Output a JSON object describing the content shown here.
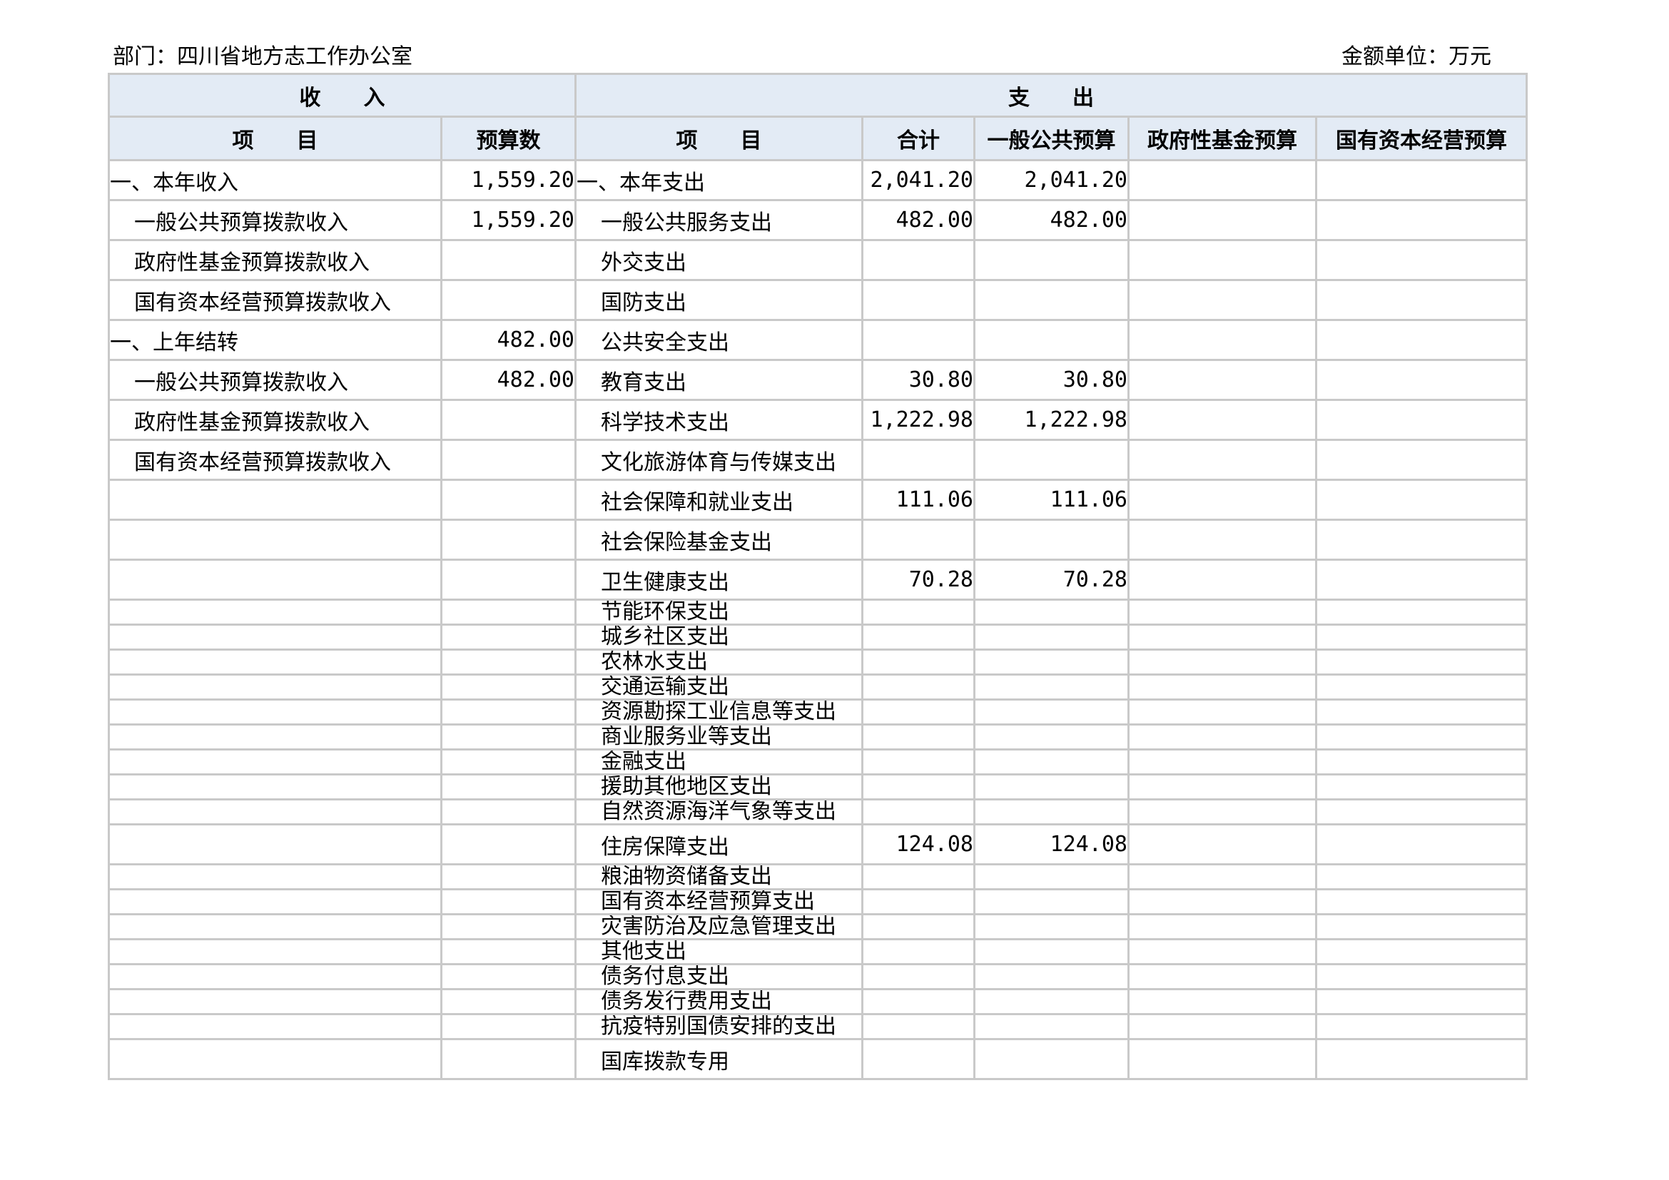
{
  "header": {
    "department": "部门：四川省地方志工作办公室",
    "unit": "金额单位：万元"
  },
  "sections": {
    "income": "收　　入",
    "expense": "支　　出"
  },
  "columns": {
    "income_item": "项　　目",
    "income_budget": "预算数",
    "expense_item": "项　　目",
    "total": "合计",
    "general": "一般公共预算",
    "fund": "政府性基金预算",
    "state_capital": "国有资本经营预算"
  },
  "rows": [
    {
      "inc": "一、本年收入",
      "inc_v": "1,559.20",
      "exp": "一、本年支出",
      "tot": "2,041.20",
      "gen": "2,041.20",
      "fund": "",
      "cap": "",
      "size": "big",
      "inc_ind": false,
      "exp_ind": false
    },
    {
      "inc": "一般公共预算拨款收入",
      "inc_v": "1,559.20",
      "exp": "一般公共服务支出",
      "tot": "482.00",
      "gen": "482.00",
      "fund": "",
      "cap": "",
      "size": "big",
      "inc_ind": true,
      "exp_ind": true
    },
    {
      "inc": "政府性基金预算拨款收入",
      "inc_v": "",
      "exp": "外交支出",
      "tot": "",
      "gen": "",
      "fund": "",
      "cap": "",
      "size": "big",
      "inc_ind": true,
      "exp_ind": true
    },
    {
      "inc": "国有资本经营预算拨款收入",
      "inc_v": "",
      "exp": "国防支出",
      "tot": "",
      "gen": "",
      "fund": "",
      "cap": "",
      "size": "big",
      "inc_ind": true,
      "exp_ind": true
    },
    {
      "inc": "一、上年结转",
      "inc_v": "482.00",
      "exp": "公共安全支出",
      "tot": "",
      "gen": "",
      "fund": "",
      "cap": "",
      "size": "big",
      "inc_ind": false,
      "exp_ind": true
    },
    {
      "inc": "一般公共预算拨款收入",
      "inc_v": "482.00",
      "exp": "教育支出",
      "tot": "30.80",
      "gen": "30.80",
      "fund": "",
      "cap": "",
      "size": "big",
      "inc_ind": true,
      "exp_ind": true
    },
    {
      "inc": "政府性基金预算拨款收入",
      "inc_v": "",
      "exp": "科学技术支出",
      "tot": "1,222.98",
      "gen": "1,222.98",
      "fund": "",
      "cap": "",
      "size": "big",
      "inc_ind": true,
      "exp_ind": true
    },
    {
      "inc": "国有资本经营预算拨款收入",
      "inc_v": "",
      "exp": "文化旅游体育与传媒支出",
      "tot": "",
      "gen": "",
      "fund": "",
      "cap": "",
      "size": "big",
      "inc_ind": true,
      "exp_ind": true
    },
    {
      "inc": "",
      "inc_v": "",
      "exp": "社会保障和就业支出",
      "tot": "111.06",
      "gen": "111.06",
      "fund": "",
      "cap": "",
      "size": "big",
      "inc_ind": false,
      "exp_ind": true
    },
    {
      "inc": "",
      "inc_v": "",
      "exp": "社会保险基金支出",
      "tot": "",
      "gen": "",
      "fund": "",
      "cap": "",
      "size": "big",
      "inc_ind": false,
      "exp_ind": true
    },
    {
      "inc": "",
      "inc_v": "",
      "exp": "卫生健康支出",
      "tot": "70.28",
      "gen": "70.28",
      "fund": "",
      "cap": "",
      "size": "big",
      "inc_ind": false,
      "exp_ind": true
    },
    {
      "inc": "",
      "inc_v": "",
      "exp": "节能环保支出",
      "tot": "",
      "gen": "",
      "fund": "",
      "cap": "",
      "size": "small",
      "inc_ind": false,
      "exp_ind": true
    },
    {
      "inc": "",
      "inc_v": "",
      "exp": "城乡社区支出",
      "tot": "",
      "gen": "",
      "fund": "",
      "cap": "",
      "size": "small",
      "inc_ind": false,
      "exp_ind": true
    },
    {
      "inc": "",
      "inc_v": "",
      "exp": "农林水支出",
      "tot": "",
      "gen": "",
      "fund": "",
      "cap": "",
      "size": "small",
      "inc_ind": false,
      "exp_ind": true
    },
    {
      "inc": "",
      "inc_v": "",
      "exp": "交通运输支出",
      "tot": "",
      "gen": "",
      "fund": "",
      "cap": "",
      "size": "small",
      "inc_ind": false,
      "exp_ind": true
    },
    {
      "inc": "",
      "inc_v": "",
      "exp": "资源勘探工业信息等支出",
      "tot": "",
      "gen": "",
      "fund": "",
      "cap": "",
      "size": "small",
      "inc_ind": false,
      "exp_ind": true
    },
    {
      "inc": "",
      "inc_v": "",
      "exp": "商业服务业等支出",
      "tot": "",
      "gen": "",
      "fund": "",
      "cap": "",
      "size": "small",
      "inc_ind": false,
      "exp_ind": true
    },
    {
      "inc": "",
      "inc_v": "",
      "exp": "金融支出",
      "tot": "",
      "gen": "",
      "fund": "",
      "cap": "",
      "size": "small",
      "inc_ind": false,
      "exp_ind": true
    },
    {
      "inc": "",
      "inc_v": "",
      "exp": "援助其他地区支出",
      "tot": "",
      "gen": "",
      "fund": "",
      "cap": "",
      "size": "small",
      "inc_ind": false,
      "exp_ind": true
    },
    {
      "inc": "",
      "inc_v": "",
      "exp": "自然资源海洋气象等支出",
      "tot": "",
      "gen": "",
      "fund": "",
      "cap": "",
      "size": "small",
      "inc_ind": false,
      "exp_ind": true
    },
    {
      "inc": "",
      "inc_v": "",
      "exp": "住房保障支出",
      "tot": "124.08",
      "gen": "124.08",
      "fund": "",
      "cap": "",
      "size": "big",
      "inc_ind": false,
      "exp_ind": true
    },
    {
      "inc": "",
      "inc_v": "",
      "exp": "粮油物资储备支出",
      "tot": "",
      "gen": "",
      "fund": "",
      "cap": "",
      "size": "small",
      "inc_ind": false,
      "exp_ind": true
    },
    {
      "inc": "",
      "inc_v": "",
      "exp": "国有资本经营预算支出",
      "tot": "",
      "gen": "",
      "fund": "",
      "cap": "",
      "size": "small",
      "inc_ind": false,
      "exp_ind": true
    },
    {
      "inc": "",
      "inc_v": "",
      "exp": "灾害防治及应急管理支出",
      "tot": "",
      "gen": "",
      "fund": "",
      "cap": "",
      "size": "small",
      "inc_ind": false,
      "exp_ind": true
    },
    {
      "inc": "",
      "inc_v": "",
      "exp": "其他支出",
      "tot": "",
      "gen": "",
      "fund": "",
      "cap": "",
      "size": "small",
      "inc_ind": false,
      "exp_ind": true
    },
    {
      "inc": "",
      "inc_v": "",
      "exp": "债务付息支出",
      "tot": "",
      "gen": "",
      "fund": "",
      "cap": "",
      "size": "small",
      "inc_ind": false,
      "exp_ind": true
    },
    {
      "inc": "",
      "inc_v": "",
      "exp": "债务发行费用支出",
      "tot": "",
      "gen": "",
      "fund": "",
      "cap": "",
      "size": "small",
      "inc_ind": false,
      "exp_ind": true
    },
    {
      "inc": "",
      "inc_v": "",
      "exp": "抗疫特别国债安排的支出",
      "tot": "",
      "gen": "",
      "fund": "",
      "cap": "",
      "size": "small",
      "inc_ind": false,
      "exp_ind": true
    },
    {
      "inc": "",
      "inc_v": "",
      "exp": "国库拨款专用",
      "tot": "",
      "gen": "",
      "fund": "",
      "cap": "",
      "size": "big",
      "inc_ind": false,
      "exp_ind": true
    }
  ]
}
